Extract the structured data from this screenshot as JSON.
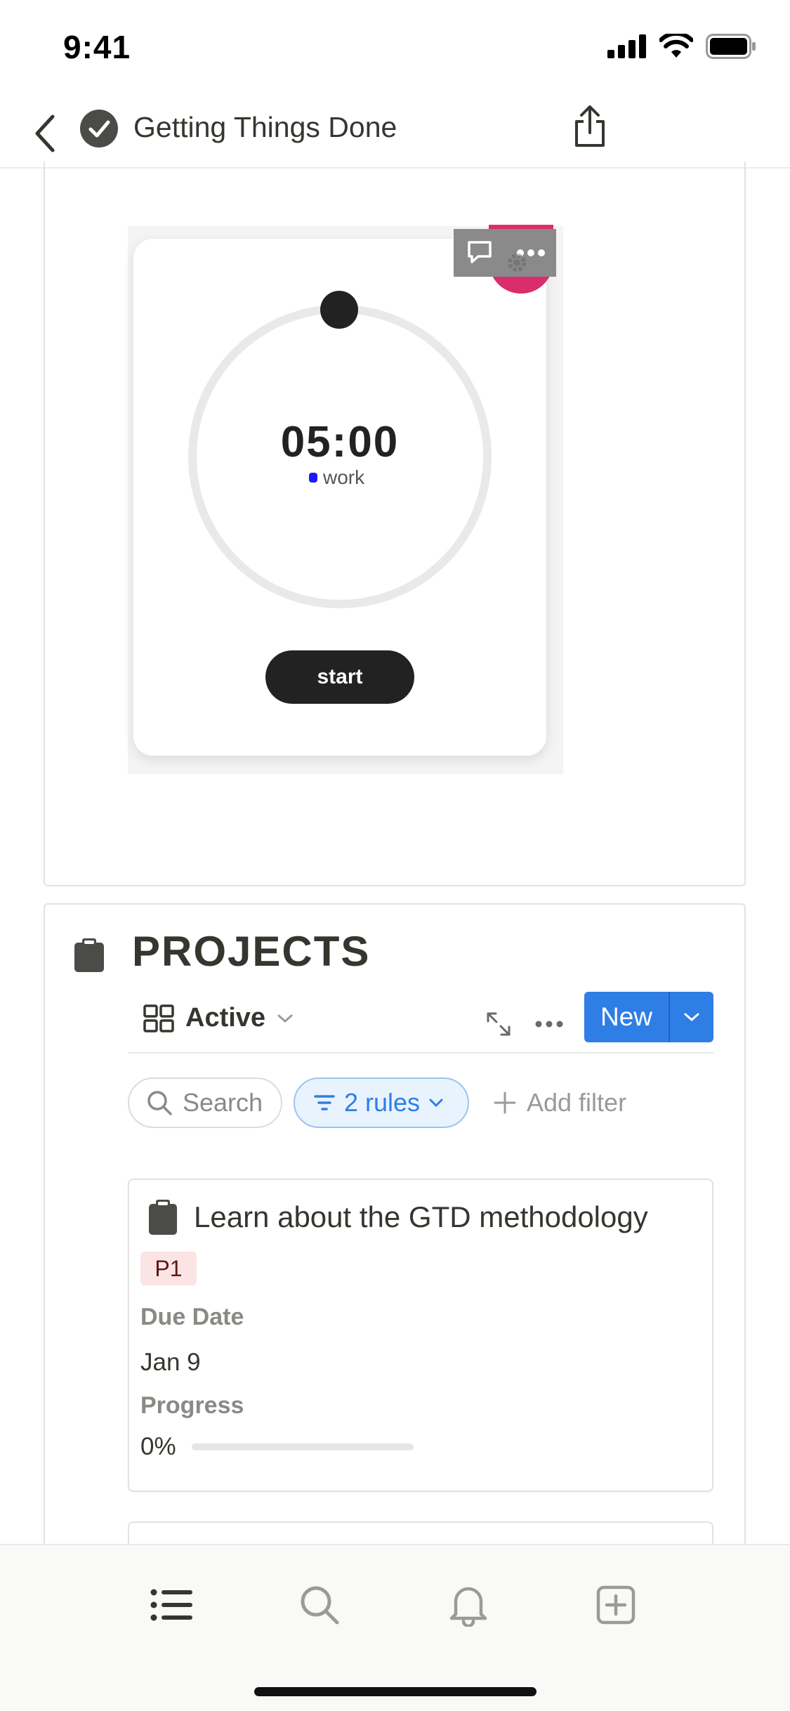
{
  "status_bar": {
    "time": "9:41"
  },
  "nav": {
    "title": "Getting Things Done"
  },
  "timer_widget": {
    "time": "05:00",
    "mode": "work",
    "start_label": "start",
    "mode_color": "#1a1aff",
    "badge_color": "#d81b60"
  },
  "database": {
    "title": "PROJECTS",
    "view_label": "Active",
    "new_label": "New",
    "search_label": "Search",
    "rules_label": "2 rules",
    "add_filter_label": "Add filter",
    "accent_color": "#2f7ee6"
  },
  "cards": [
    {
      "title": "Learn about the GTD methodology",
      "priority": "P1",
      "due_label": "Due Date",
      "due_value": "Jan 9",
      "progress_label": "Progress",
      "progress_text": "0%",
      "progress_value": 0
    }
  ],
  "tab_bar": {
    "items": [
      "list-icon",
      "search-icon",
      "bell-icon",
      "add-page-icon"
    ]
  }
}
